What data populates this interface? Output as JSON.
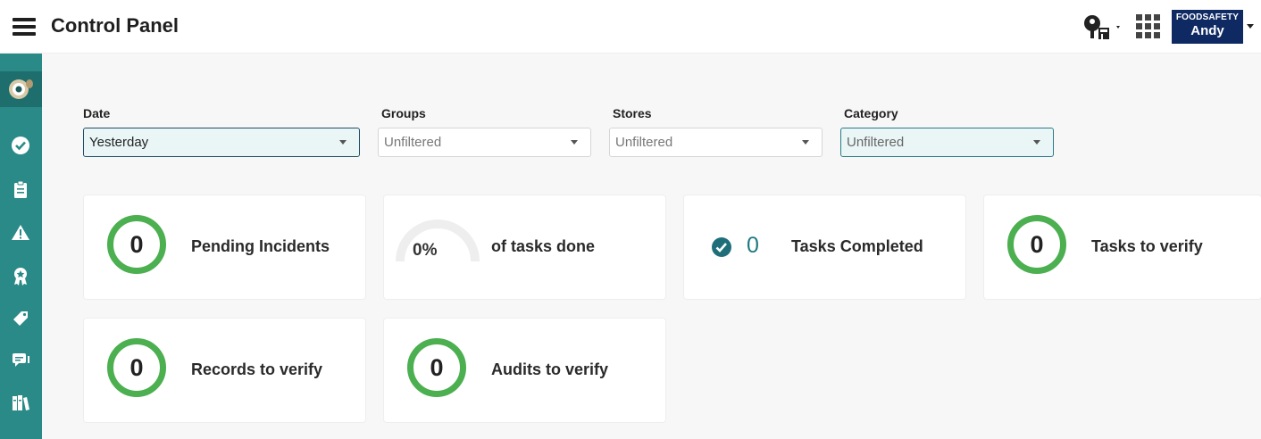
{
  "header": {
    "title": "Control Panel",
    "logo": {
      "top": "FOODSAFETY",
      "bottom": "Andy"
    }
  },
  "sidebar": {
    "items": [
      {
        "icon": "checkmark-circle-icon"
      },
      {
        "icon": "clipboard-icon"
      },
      {
        "icon": "warning-icon"
      },
      {
        "icon": "award-icon"
      },
      {
        "icon": "tag-icon"
      },
      {
        "icon": "chat-icon"
      },
      {
        "icon": "books-icon"
      }
    ]
  },
  "filters": {
    "date": {
      "label": "Date",
      "value": "Yesterday"
    },
    "groups": {
      "label": "Groups",
      "value": "Unfiltered"
    },
    "stores": {
      "label": "Stores",
      "value": "Unfiltered"
    },
    "category": {
      "label": "Category",
      "value": "Unfiltered"
    }
  },
  "cards": {
    "pending_incidents": {
      "value": "0",
      "label": "Pending Incidents"
    },
    "tasks_done": {
      "value": "0%",
      "label": "of tasks done",
      "progress": 0
    },
    "tasks_completed": {
      "value": "0",
      "label": "Tasks Completed"
    },
    "tasks_to_verify": {
      "value": "0",
      "label": "Tasks to verify"
    },
    "records_to_verify": {
      "value": "0",
      "label": "Records to verify"
    },
    "audits_to_verify": {
      "value": "0",
      "label": "Audits to verify"
    }
  },
  "colors": {
    "accent": "#2a8a88",
    "ring": "#4caf50",
    "brand": "#0f2a63"
  }
}
